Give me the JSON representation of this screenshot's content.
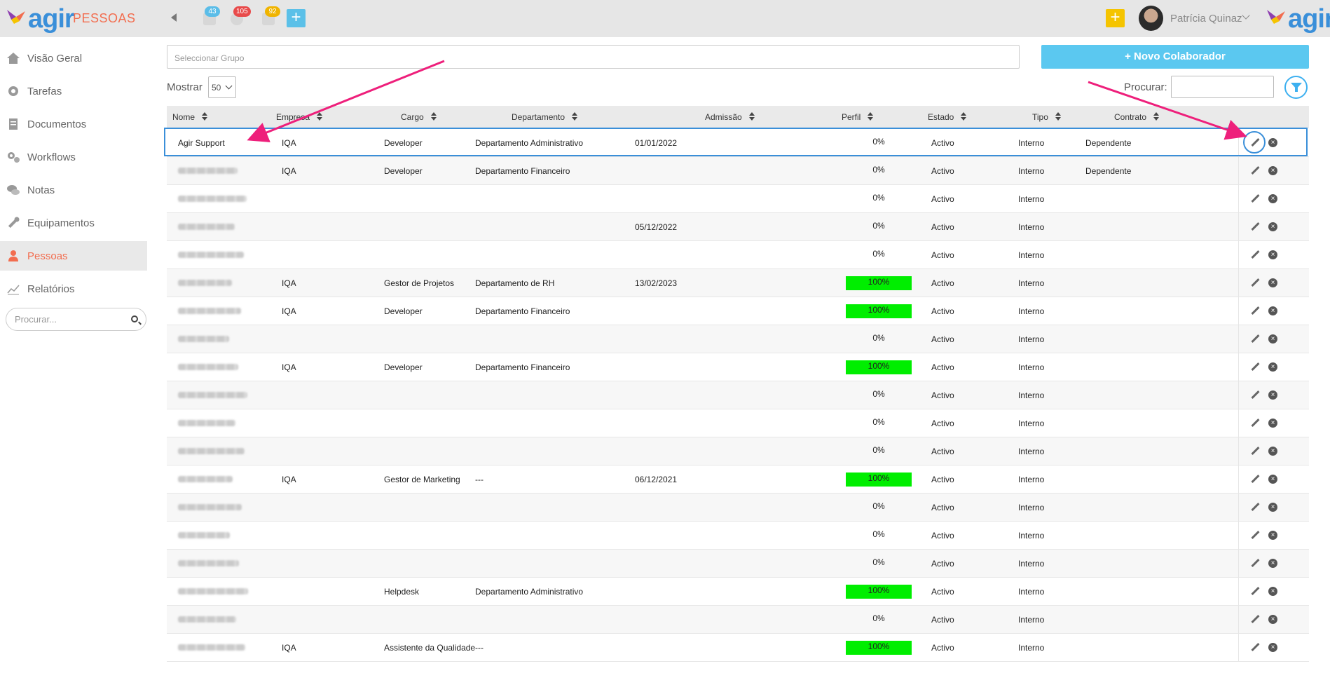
{
  "topbar": {
    "brand": "agir",
    "module_title": "PESSOAS",
    "badges": [
      {
        "name": "calendar",
        "count": "43",
        "color": "#5bbde8"
      },
      {
        "name": "settings",
        "count": "105",
        "color": "#e84a4a"
      },
      {
        "name": "documents",
        "count": "92",
        "color": "#f0b400"
      }
    ],
    "add_icon": "+",
    "user_name": "Patrícia Quinaz"
  },
  "sidebar": {
    "items": [
      {
        "label": "Visão Geral",
        "icon": "home-icon"
      },
      {
        "label": "Tarefas",
        "icon": "gear-icon"
      },
      {
        "label": "Documentos",
        "icon": "document-icon"
      },
      {
        "label": "Workflows",
        "icon": "gears-icon"
      },
      {
        "label": "Notas",
        "icon": "chat-icon"
      },
      {
        "label": "Equipamentos",
        "icon": "wrench-icon"
      },
      {
        "label": "Pessoas",
        "icon": "person-icon",
        "active": true
      },
      {
        "label": "Relatórios",
        "icon": "chart-icon"
      }
    ],
    "search_placeholder": "Procurar..."
  },
  "main": {
    "group_placeholder": "Seleccionar Grupo",
    "new_button": "+ Novo Colaborador",
    "show_label": "Mostrar",
    "show_value": "50",
    "search_label": "Procurar:",
    "columns": [
      "Nome",
      "Empresa",
      "Cargo",
      "Departamento",
      "Admissão",
      "Perfil",
      "Estado",
      "Tipo",
      "Contrato"
    ],
    "rows": [
      {
        "nome": "Agir Support",
        "empresa": "IQA",
        "cargo": "Developer",
        "departamento": "Departamento Administrativo",
        "admissao": "01/01/2022",
        "perfil": "0%",
        "perfil_full": false,
        "estado": "Activo",
        "tipo": "Interno",
        "contrato": "Dependente"
      },
      {
        "nome": "",
        "empresa": "IQA",
        "cargo": "Developer",
        "departamento": "Departamento Financeiro",
        "admissao": "",
        "perfil": "0%",
        "perfil_full": false,
        "estado": "Activo",
        "tipo": "Interno",
        "contrato": "Dependente"
      },
      {
        "nome": "",
        "empresa": "",
        "cargo": "",
        "departamento": "",
        "admissao": "",
        "perfil": "0%",
        "perfil_full": false,
        "estado": "Activo",
        "tipo": "Interno",
        "contrato": ""
      },
      {
        "nome": "",
        "empresa": "",
        "cargo": "",
        "departamento": "",
        "admissao": "05/12/2022",
        "perfil": "0%",
        "perfil_full": false,
        "estado": "Activo",
        "tipo": "Interno",
        "contrato": ""
      },
      {
        "nome": "",
        "empresa": "",
        "cargo": "",
        "departamento": "",
        "admissao": "",
        "perfil": "0%",
        "perfil_full": false,
        "estado": "Activo",
        "tipo": "Interno",
        "contrato": ""
      },
      {
        "nome": "",
        "empresa": "IQA",
        "cargo": "Gestor de Projetos",
        "departamento": "Departamento de RH",
        "admissao": "13/02/2023",
        "perfil": "100%",
        "perfil_full": true,
        "estado": "Activo",
        "tipo": "Interno",
        "contrato": ""
      },
      {
        "nome": "",
        "empresa": "IQA",
        "cargo": "Developer",
        "departamento": "Departamento Financeiro",
        "admissao": "",
        "perfil": "100%",
        "perfil_full": true,
        "estado": "Activo",
        "tipo": "Interno",
        "contrato": ""
      },
      {
        "nome": "",
        "empresa": "",
        "cargo": "",
        "departamento": "",
        "admissao": "",
        "perfil": "0%",
        "perfil_full": false,
        "estado": "Activo",
        "tipo": "Interno",
        "contrato": ""
      },
      {
        "nome": "",
        "empresa": "IQA",
        "cargo": "Developer",
        "departamento": "Departamento Financeiro",
        "admissao": "",
        "perfil": "100%",
        "perfil_full": true,
        "estado": "Activo",
        "tipo": "Interno",
        "contrato": ""
      },
      {
        "nome": "",
        "empresa": "",
        "cargo": "",
        "departamento": "",
        "admissao": "",
        "perfil": "0%",
        "perfil_full": false,
        "estado": "Activo",
        "tipo": "Interno",
        "contrato": ""
      },
      {
        "nome": "",
        "empresa": "",
        "cargo": "",
        "departamento": "",
        "admissao": "",
        "perfil": "0%",
        "perfil_full": false,
        "estado": "Activo",
        "tipo": "Interno",
        "contrato": ""
      },
      {
        "nome": "",
        "empresa": "",
        "cargo": "",
        "departamento": "",
        "admissao": "",
        "perfil": "0%",
        "perfil_full": false,
        "estado": "Activo",
        "tipo": "Interno",
        "contrato": ""
      },
      {
        "nome": "",
        "empresa": "IQA",
        "cargo": "Gestor de Marketing",
        "departamento": "---",
        "admissao": "06/12/2021",
        "perfil": "100%",
        "perfil_full": true,
        "estado": "Activo",
        "tipo": "Interno",
        "contrato": ""
      },
      {
        "nome": "",
        "empresa": "",
        "cargo": "",
        "departamento": "",
        "admissao": "",
        "perfil": "0%",
        "perfil_full": false,
        "estado": "Activo",
        "tipo": "Interno",
        "contrato": ""
      },
      {
        "nome": "",
        "empresa": "",
        "cargo": "",
        "departamento": "",
        "admissao": "",
        "perfil": "0%",
        "perfil_full": false,
        "estado": "Activo",
        "tipo": "Interno",
        "contrato": ""
      },
      {
        "nome": "",
        "empresa": "",
        "cargo": "",
        "departamento": "",
        "admissao": "",
        "perfil": "0%",
        "perfil_full": false,
        "estado": "Activo",
        "tipo": "Interno",
        "contrato": ""
      },
      {
        "nome": "",
        "empresa": "",
        "cargo": "Helpdesk",
        "departamento": "Departamento Administrativo",
        "admissao": "",
        "perfil": "100%",
        "perfil_full": true,
        "estado": "Activo",
        "tipo": "Interno",
        "contrato": ""
      },
      {
        "nome": "",
        "empresa": "",
        "cargo": "",
        "departamento": "",
        "admissao": "",
        "perfil": "0%",
        "perfil_full": false,
        "estado": "Activo",
        "tipo": "Interno",
        "contrato": ""
      },
      {
        "nome": "",
        "empresa": "IQA",
        "cargo": "Assistente da Qualidade",
        "departamento": "---",
        "admissao": "",
        "perfil": "100%",
        "perfil_full": true,
        "estado": "Activo",
        "tipo": "Interno",
        "contrato": ""
      }
    ]
  },
  "colors": {
    "accent_orange": "#f26d4f",
    "accent_blue": "#3a8fd9",
    "button_blue": "#5bc8f0",
    "perfil_green": "#00ee00",
    "annotation_pink": "#ee1f7b"
  }
}
